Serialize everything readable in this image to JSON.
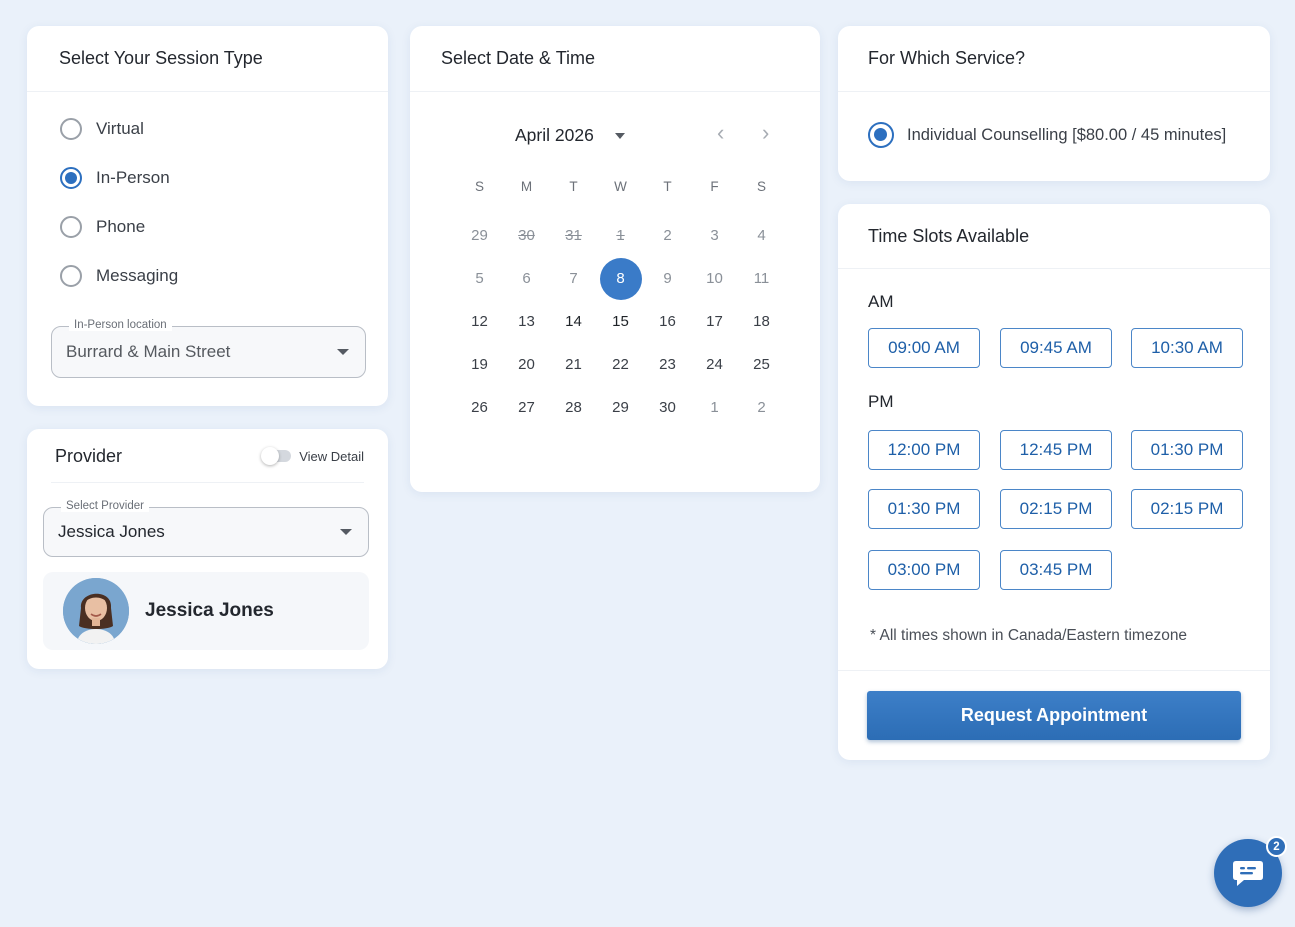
{
  "session": {
    "title": "Select Your Session Type",
    "options": [
      {
        "label": "Virtual",
        "checked": false
      },
      {
        "label": "In-Person",
        "checked": true
      },
      {
        "label": "Phone",
        "checked": false
      },
      {
        "label": "Messaging",
        "checked": false
      }
    ],
    "location_legend": "In-Person location",
    "location_value": "Burrard & Main Street"
  },
  "provider": {
    "title": "Provider",
    "toggle_label": "View Detail",
    "select_legend": "Select Provider",
    "select_value": "Jessica Jones",
    "card_name": "Jessica Jones"
  },
  "calendar": {
    "title": "Select Date & Time",
    "month": "April 2026",
    "weekdays": [
      "S",
      "M",
      "T",
      "W",
      "T",
      "F",
      "S"
    ],
    "days": [
      {
        "d": "29",
        "s": "muted"
      },
      {
        "d": "30",
        "s": "struck"
      },
      {
        "d": "31",
        "s": "struck"
      },
      {
        "d": "1",
        "s": "struck"
      },
      {
        "d": "2",
        "s": "muted"
      },
      {
        "d": "3",
        "s": "muted"
      },
      {
        "d": "4",
        "s": "muted"
      },
      {
        "d": "5",
        "s": "muted"
      },
      {
        "d": "6",
        "s": "muted"
      },
      {
        "d": "7",
        "s": "muted"
      },
      {
        "d": "8",
        "s": "selected"
      },
      {
        "d": "9",
        "s": "muted"
      },
      {
        "d": "10",
        "s": "muted"
      },
      {
        "d": "11",
        "s": "muted"
      },
      {
        "d": "12",
        "s": ""
      },
      {
        "d": "13",
        "s": ""
      },
      {
        "d": "14",
        "s": "bold"
      },
      {
        "d": "15",
        "s": "bold"
      },
      {
        "d": "16",
        "s": ""
      },
      {
        "d": "17",
        "s": ""
      },
      {
        "d": "18",
        "s": ""
      },
      {
        "d": "19",
        "s": ""
      },
      {
        "d": "20",
        "s": ""
      },
      {
        "d": "21",
        "s": ""
      },
      {
        "d": "22",
        "s": ""
      },
      {
        "d": "23",
        "s": ""
      },
      {
        "d": "24",
        "s": ""
      },
      {
        "d": "25",
        "s": ""
      },
      {
        "d": "26",
        "s": ""
      },
      {
        "d": "27",
        "s": ""
      },
      {
        "d": "28",
        "s": ""
      },
      {
        "d": "29",
        "s": ""
      },
      {
        "d": "30",
        "s": ""
      },
      {
        "d": "1",
        "s": "muted"
      },
      {
        "d": "2",
        "s": "muted"
      }
    ]
  },
  "service": {
    "title": "For Which Service?",
    "option": "Individual Counselling [$80.00 / 45 minutes]"
  },
  "slots": {
    "title": "Time Slots Available",
    "am_label": "AM",
    "pm_label": "PM",
    "am": [
      "09:00 AM",
      "09:45 AM",
      "10:30 AM"
    ],
    "pm": [
      "12:00 PM",
      "12:45 PM",
      "01:30 PM",
      "01:30 PM",
      "02:15 PM",
      "02:15 PM",
      "03:00 PM",
      "03:45 PM"
    ],
    "note": "* All times shown in Canada/Eastern timezone",
    "button": "Request Appointment"
  },
  "chat": {
    "badge": "2"
  },
  "icons": {
    "chat": "chat-icon",
    "prev": "chevron-left-icon",
    "next": "chevron-right-icon"
  },
  "colors": {
    "accent": "#3a7bc8",
    "button": "#2c6db5",
    "background": "#eaf1fa"
  }
}
